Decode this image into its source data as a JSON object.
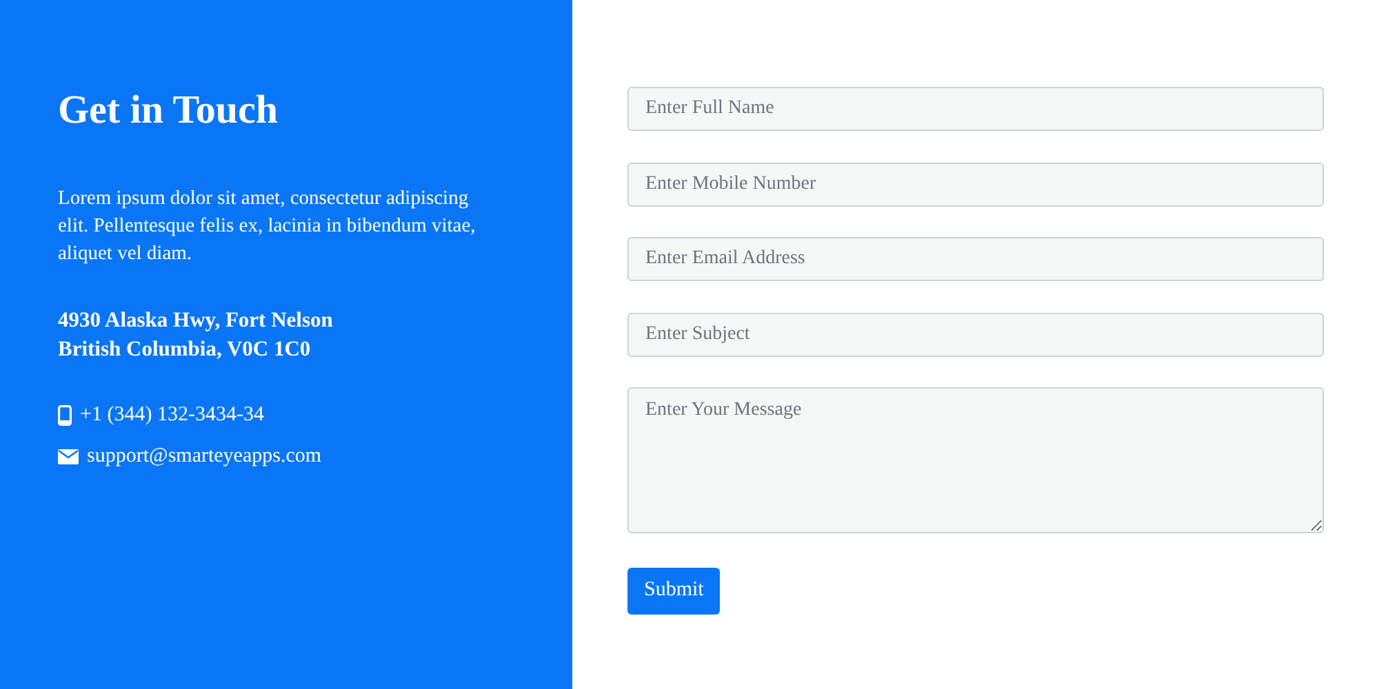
{
  "contact": {
    "title": "Get in Touch",
    "description": "Lorem ipsum dolor sit amet, consectetur adipiscing elit. Pellentesque felis ex, lacinia in bibendum vitae, aliquet vel diam.",
    "address": [
      "4930 Alaska Hwy, Fort Nelson",
      "British Columbia, V0C 1C0"
    ],
    "details": [
      {
        "kind": "phone",
        "text": "+1 (344) 132-3434-34"
      },
      {
        "kind": "email",
        "text": "support@smarteyeapps.com"
      }
    ]
  },
  "form": {
    "fields": [
      {
        "kind": "input",
        "placeholder": "Enter Full Name"
      },
      {
        "kind": "input",
        "placeholder": "Enter Mobile Number"
      },
      {
        "kind": "input",
        "placeholder": "Enter Email Address"
      },
      {
        "kind": "input",
        "placeholder": "Enter Subject"
      },
      {
        "kind": "textarea",
        "placeholder": "Enter Your Message"
      }
    ],
    "submit": "Submit"
  }
}
